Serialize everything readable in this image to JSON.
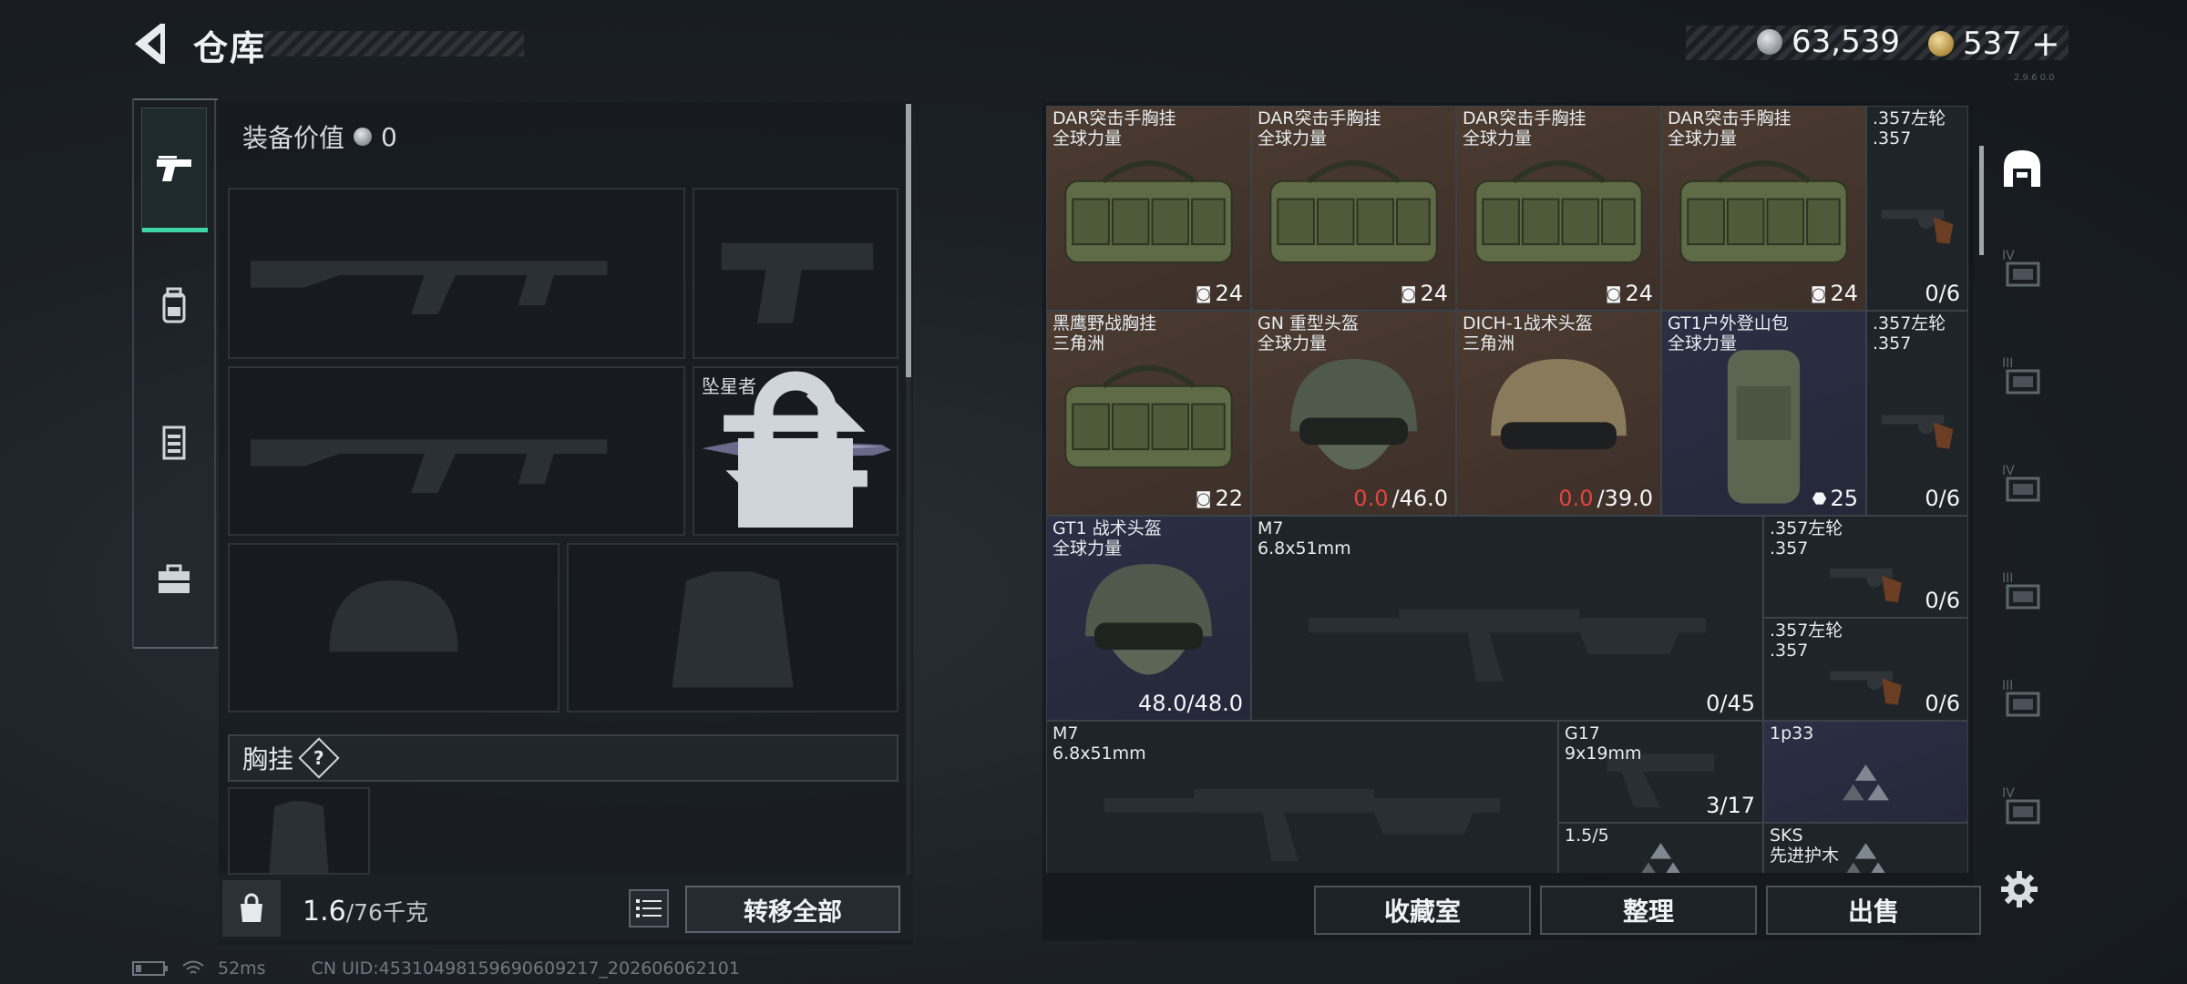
{
  "header": {
    "title": "仓库",
    "currency_silver": "63,539",
    "currency_gold": "537",
    "gold_add": "+",
    "version": "2.9.6 0.0"
  },
  "equipment": {
    "value_label": "装备价值",
    "value": "0",
    "melee_name": "坠星者",
    "vest_label": "胸挂",
    "help": "?",
    "weight_current": "1.6",
    "weight_max": "/76千克",
    "transfer_all": "转移全部"
  },
  "left_tabs": [
    "weapon-tab",
    "backpack-tab",
    "armor-tab",
    "toolbox-tab"
  ],
  "status": {
    "ping": "52ms",
    "uid": "CN UID:45310498159690609217_202606062101"
  },
  "inventory": {
    "items": [
      {
        "name": "DAR突击手胸挂",
        "sub": "全球力量",
        "count": "24",
        "bg": "brown",
        "kind": "vest"
      },
      {
        "name": "DAR突击手胸挂",
        "sub": "全球力量",
        "count": "24",
        "bg": "brown",
        "kind": "vest"
      },
      {
        "name": "DAR突击手胸挂",
        "sub": "全球力量",
        "count": "24",
        "bg": "brown",
        "kind": "vest"
      },
      {
        "name": "DAR突击手胸挂",
        "sub": "全球力量",
        "count": "24",
        "bg": "brown",
        "kind": "vest"
      },
      {
        "name": ".357左轮",
        "sub": ".357",
        "count": "0/6",
        "bg": "dark",
        "kind": "revolver"
      },
      {
        "name": "黑鹰野战胸挂",
        "sub": "三角洲",
        "count": "22",
        "bg": "brown",
        "kind": "vest"
      },
      {
        "name": "GN 重型头盔",
        "sub": "全球力量",
        "dur_cur": "0.0",
        "dur_max": "/46.0",
        "bg": "brown",
        "kind": "helmet"
      },
      {
        "name": "DICH-1战术头盔",
        "sub": "三角洲",
        "dur_cur": "0.0",
        "dur_max": "/39.0",
        "bg": "brown",
        "kind": "helmet2"
      },
      {
        "name": "GT1户外登山包",
        "sub": "全球力量",
        "count": "25",
        "bg": "navy",
        "kind": "pack"
      },
      {
        "name": ".357左轮",
        "sub": ".357",
        "count": "0/6",
        "bg": "dark",
        "kind": "revolver"
      },
      {
        "name": "GT1 战术头盔",
        "sub": "全球力量",
        "count": "48.0/48.0",
        "bg": "navy",
        "kind": "helmet"
      },
      {
        "name": "M7",
        "sub": "6.8x51mm",
        "count": "0/45",
        "bg": "dark",
        "kind": "rifle"
      },
      {
        "name": ".357左轮",
        "sub": ".357",
        "count": "0/6",
        "bg": "dark",
        "kind": "revolver"
      },
      {
        "name": ".357左轮",
        "sub": ".357",
        "count": "0/6",
        "bg": "dark",
        "kind": "revolver"
      },
      {
        "name": "M7",
        "sub": "6.8x51mm",
        "count": "",
        "bg": "dark",
        "kind": "rifle"
      },
      {
        "name": "G17",
        "sub": "9x19mm",
        "count": "3/17",
        "bg": "dark",
        "kind": "pistol"
      },
      {
        "name": "1p33",
        "sub": "",
        "count": "",
        "bg": "navy",
        "kind": "scope"
      },
      {
        "name": "1.5/5",
        "sub": "",
        "count": "",
        "bg": "dark",
        "kind": "scope"
      },
      {
        "name": "SKS",
        "sub": "先进护木",
        "count": "",
        "bg": "dark",
        "kind": "scope"
      }
    ]
  },
  "buttons": {
    "collection": "收藏室",
    "sort": "整理",
    "sell": "出售"
  },
  "right_tabs": [
    "IV",
    "III",
    "IV",
    "III",
    "III",
    "IV"
  ],
  "colors": {
    "accent": "#3fd6a5",
    "item_brown": "#4b3b31",
    "item_navy": "#2c2f45",
    "durability_red": "#e0453f"
  }
}
